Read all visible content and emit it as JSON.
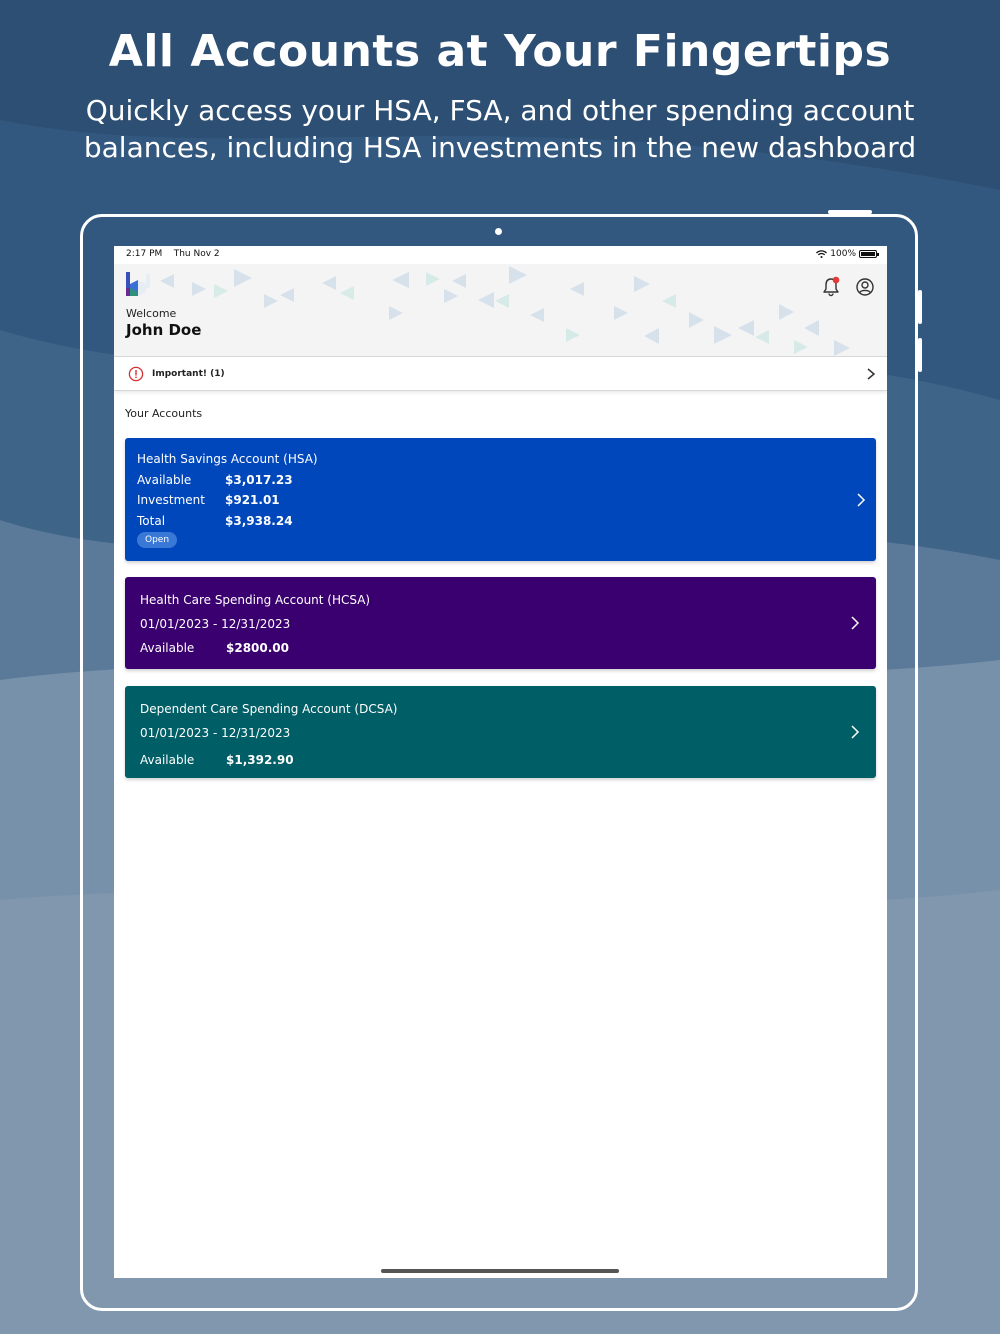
{
  "marketing": {
    "headline": "All Accounts at Your Fingertips",
    "subline": "Quickly access your HSA, FSA, and other spending account balances, including HSA investments in the new dashboard"
  },
  "statusbar": {
    "time": "2:17 PM",
    "date": "Thu Nov 2",
    "battery": "100%"
  },
  "header": {
    "welcome": "Welcome",
    "username": "John Doe"
  },
  "important": {
    "label": "Important! (1)"
  },
  "accounts_title": "Your Accounts",
  "accounts": {
    "hsa": {
      "name": "Health Savings Account (HSA)",
      "available_label": "Available",
      "available_value": "$3,017.23",
      "investment_label": "Investment",
      "investment_value": "$921.01",
      "total_label": "Total",
      "total_value": "$3,938.24",
      "status": "Open"
    },
    "hcsa": {
      "name": "Health Care Spending Account (HCSA)",
      "period": "01/01/2023 - 12/31/2023",
      "available_label": "Available",
      "available_value": "$2800.00"
    },
    "dcsa": {
      "name": "Dependent Care Spending Account (DCSA)",
      "period": "01/01/2023 - 12/31/2023",
      "available_label": "Available",
      "available_value": "$1,392.90"
    }
  },
  "colors": {
    "hsa": "#0047bb",
    "hcsa": "#3b0070",
    "dcsa": "#005e66",
    "background": "#2f5277",
    "notification_dot": "#e53935"
  }
}
